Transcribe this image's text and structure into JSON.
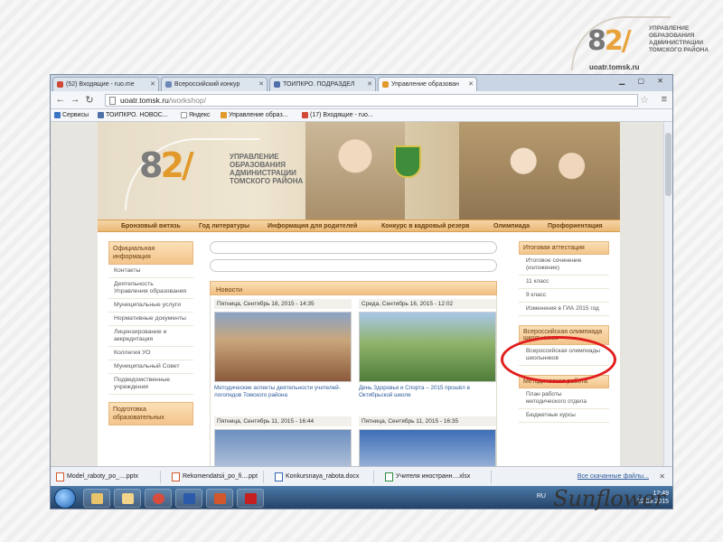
{
  "logo": {
    "mark": "8",
    "mark_accent": "2/",
    "lines": [
      "УПРАВЛЕНИЕ",
      "ОБРАЗОВАНИЯ",
      "АДМИНИСТРАЦИИ",
      "ТОМСКОГО РАЙОНА"
    ],
    "url": "uoatr.tomsk.ru"
  },
  "browser": {
    "tabs": [
      {
        "label": "(52) Входящие - ruo.me",
        "color": "#d14836",
        "active": false
      },
      {
        "label": "Всероссийский конкур",
        "color": "#6d87b6",
        "active": false
      },
      {
        "label": "ТОИПКРО. ПОДРАЗДЕЛ",
        "color": "#4e6fa8",
        "active": false
      },
      {
        "label": "Управление образован",
        "color": "#e39a2c",
        "active": true
      }
    ],
    "address": {
      "host": "uoatr.tomsk.ru",
      "path": "/workshop/"
    },
    "bookmarks": [
      {
        "label": "Сервисы",
        "color": "#3b73c4"
      },
      {
        "label": "ТОИПКРО. НОВОС...",
        "color": "#4e6fa8"
      },
      {
        "label": "Яндекс",
        "color": "#ffffff"
      },
      {
        "label": "Управление образ...",
        "color": "#e39a2c"
      },
      {
        "label": "(17) Входящие - ruo...",
        "color": "#d14836"
      }
    ]
  },
  "site": {
    "banner": {
      "mark": "8",
      "mark_accent": "2/",
      "lines": [
        "УПРАВЛЕНИЕ",
        "ОБРАЗОВАНИЯ",
        "АДМИНИСТРАЦИИ",
        "ТОМСКОГО РАЙОНА"
      ]
    },
    "nav": [
      "Бронзовый витязь",
      "Год литературы",
      "Информация для родителей",
      "Конкурс в кадровый резерв",
      "Олимпиада",
      "Профориентация"
    ],
    "left_heads": [
      "Официальная информация",
      "Подготовка образовательных"
    ],
    "left_items": [
      "Контакты",
      "Деятельность Управления образования",
      "Муниципальные услуги",
      "Нормативные документы",
      "Лицензирование и аккредитация",
      "Коллегия УО",
      "Муниципальный Совет",
      "Подведомственные учреждения"
    ],
    "news_title": "Новости",
    "news": [
      {
        "date": "Пятница, Сентябрь 18, 2015 - 14:35",
        "caption": "Методические аспекты деятельности учителей-логопедов Томского района"
      },
      {
        "date": "Среда, Сентябрь 16, 2015 - 12:02",
        "caption": "День Здоровья и Спорта – 2015 прошёл в Октябрьской школе"
      },
      {
        "date": "Пятница, Сентябрь 11, 2015 - 16:44",
        "caption": ""
      },
      {
        "date": "Пятница, Сентябрь 11, 2015 - 16:35",
        "caption": ""
      }
    ],
    "right_sections": [
      {
        "head": "Итоговая аттестация",
        "items": [
          "Итоговое сочинение (изложение)",
          "11 класс",
          "9 класс",
          "Изменения в ГИА 2015 год"
        ]
      },
      {
        "head": "Всероссийская олимпиада школьников",
        "items": [
          "Всероссийская олимпиады школьников"
        ]
      },
      {
        "head": "Методическая работа",
        "items": [
          "План работы методического отдела",
          "Бюджетные курсы"
        ]
      }
    ]
  },
  "downloads": {
    "files": [
      "Model_raboty_po_....pptx",
      "Rekomendatsii_po_fi....ppt",
      "Konkursnaya_rabota.docx",
      "Учителя иностранн....xlsx"
    ],
    "all_label": "Все скачанные файлы...",
    "close": "✕"
  },
  "taskbar": {
    "lang": "RU",
    "time": "12:49",
    "date": "22.09.2015",
    "apps": [
      {
        "name": "explorer",
        "color": "#e8c46a"
      },
      {
        "name": "files",
        "color": "#f2d58a"
      },
      {
        "name": "chrome",
        "color": "#d84c3e"
      },
      {
        "name": "word",
        "color": "#2b5aa8"
      },
      {
        "name": "powerpoint",
        "color": "#d2572b"
      },
      {
        "name": "pdf",
        "color": "#c51f1f"
      }
    ]
  },
  "watermark": "Sunflower",
  "colors": {
    "accent": "#e39a2c",
    "highlight": "#e01e1e"
  }
}
